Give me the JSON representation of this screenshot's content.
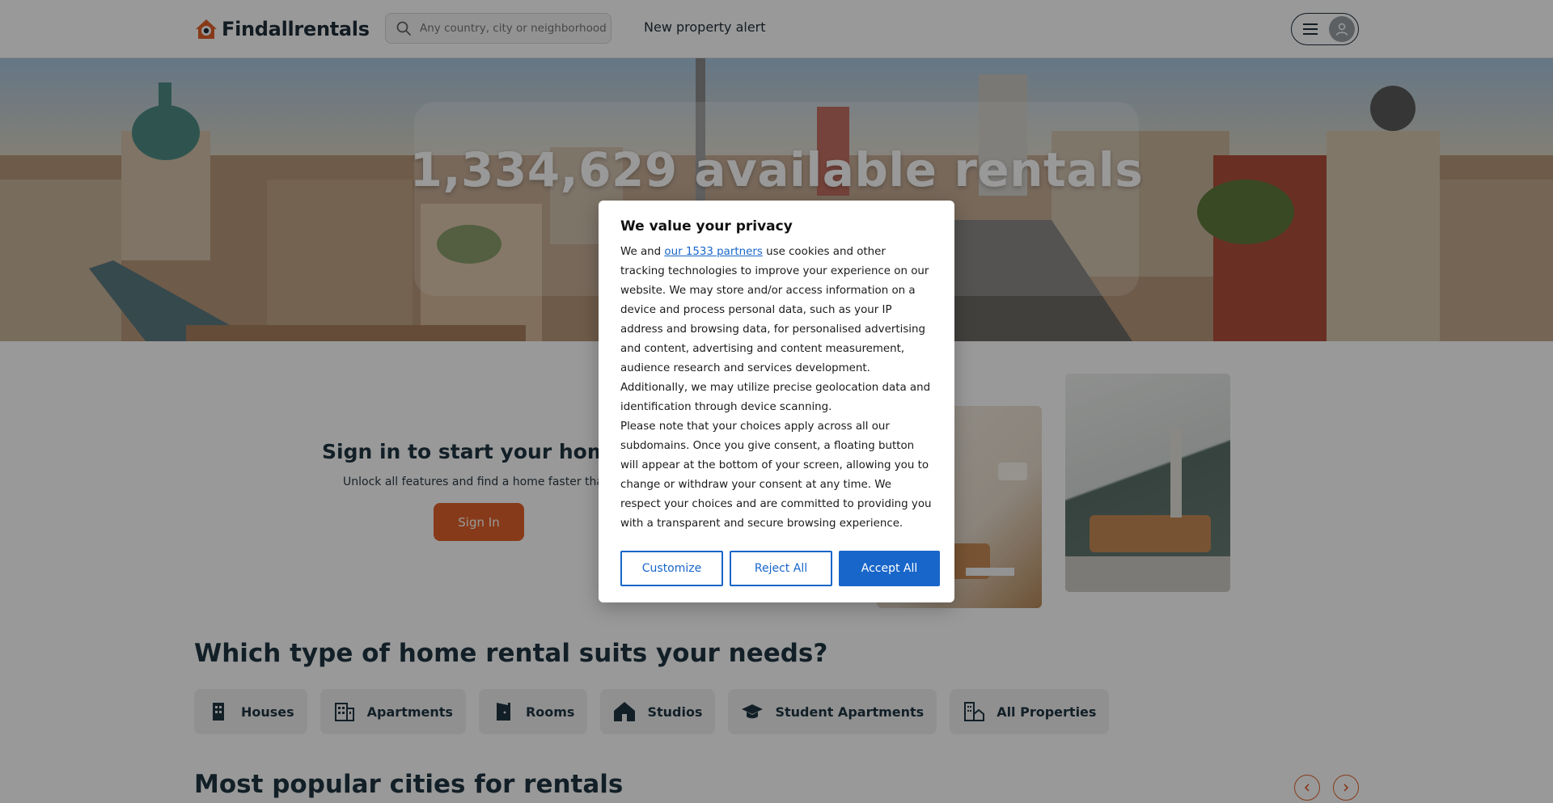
{
  "header": {
    "brand": "Findallrentals",
    "search_placeholder": "Any country, city or neighborhood",
    "alert_link": "New property alert"
  },
  "hero": {
    "title": "1,334,629 available rentals"
  },
  "signin": {
    "title": "Sign in to start your home sea",
    "subtitle": "Unlock all features and find a home faster than ev",
    "button": "Sign In"
  },
  "types": {
    "title": "Which type of home rental suits your needs?",
    "items": [
      {
        "label": "Houses",
        "icon": "building-icon"
      },
      {
        "label": "Apartments",
        "icon": "apartment-building-icon"
      },
      {
        "label": "Rooms",
        "icon": "door-icon"
      },
      {
        "label": "Studios",
        "icon": "house-icon"
      },
      {
        "label": "Student Apartments",
        "icon": "graduation-cap-icon"
      },
      {
        "label": "All Properties",
        "icon": "buildings-home-icon"
      }
    ]
  },
  "cities": {
    "title": "Most popular cities for rentals"
  },
  "consent": {
    "title": "We value your privacy",
    "intro_before": "We and ",
    "partners_link": "our 1533 partners",
    "intro_after": " use cookies and other tracking technologies to improve your experience on our website. We may store and/or access information on a device and process personal data, such as your IP address and browsing data, for personalised advertising and content, advertising and content measurement, audience research and services development. Additionally, we may utilize precise geolocation data and identification through device scanning.",
    "note": "Please note that your choices apply across all our subdomains. Once you give consent, a floating button will appear at the bottom of your screen, allowing you to change or withdraw your consent at any time. We respect your choices and are committed to providing you with a transparent and secure browsing experience.",
    "buttons": {
      "customize": "Customize",
      "reject": "Reject All",
      "accept": "Accept All"
    }
  },
  "colors": {
    "brand_orange": "#e2622b",
    "consent_blue": "#1866c9",
    "heading_dark": "#1f3442"
  }
}
